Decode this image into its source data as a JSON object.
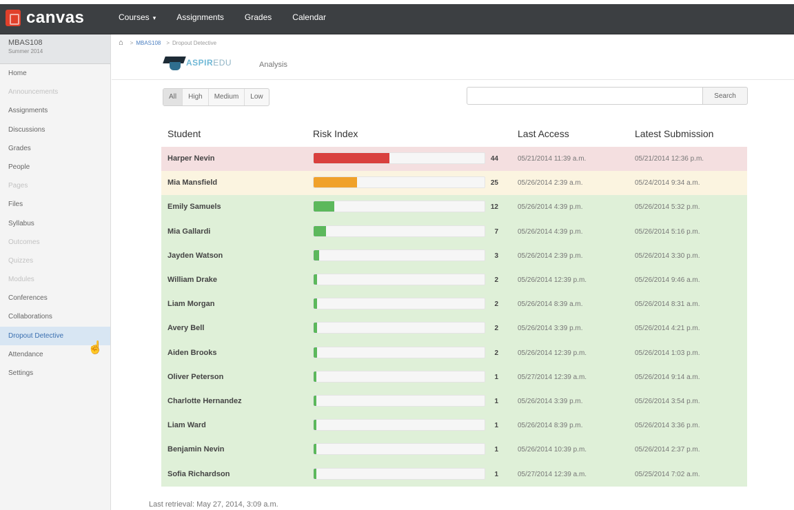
{
  "app": {
    "logo_text": "canvas"
  },
  "nav": [
    {
      "label": "Courses",
      "caret": "▾"
    },
    {
      "label": "Assignments"
    },
    {
      "label": "Grades"
    },
    {
      "label": "Calendar"
    }
  ],
  "course": {
    "code": "MBAS108",
    "term": "Summer 2014"
  },
  "sidebar": {
    "items": [
      {
        "label": "Home",
        "dim": false
      },
      {
        "label": "Announcements",
        "dim": true
      },
      {
        "label": "Assignments",
        "dim": false
      },
      {
        "label": "Discussions",
        "dim": false
      },
      {
        "label": "Grades",
        "dim": false
      },
      {
        "label": "People",
        "dim": false
      },
      {
        "label": "Pages",
        "dim": true
      },
      {
        "label": "Files",
        "dim": false
      },
      {
        "label": "Syllabus",
        "dim": false
      },
      {
        "label": "Outcomes",
        "dim": true
      },
      {
        "label": "Quizzes",
        "dim": true
      },
      {
        "label": "Modules",
        "dim": true
      },
      {
        "label": "Conferences",
        "dim": false
      },
      {
        "label": "Collaborations",
        "dim": false
      },
      {
        "label": "Dropout Detective",
        "dim": false,
        "active": true
      },
      {
        "label": "Attendance",
        "dim": false
      },
      {
        "label": "Settings",
        "dim": false
      }
    ]
  },
  "breadcrumb": {
    "course": "MBAS108",
    "separator": ">",
    "page": "Dropout Detective"
  },
  "brand": {
    "name_highlight": "ASPIR",
    "name_rest": "EDU",
    "tab": "Analysis"
  },
  "filters": [
    {
      "label": "All",
      "active": true
    },
    {
      "label": "High",
      "active": false
    },
    {
      "label": "Medium",
      "active": false
    },
    {
      "label": "Low",
      "active": false
    }
  ],
  "search": {
    "value": "",
    "placeholder": "",
    "button": "Search"
  },
  "table": {
    "headers": {
      "student": "Student",
      "risk": "Risk Index",
      "access": "Last Access",
      "submission": "Latest Submission"
    },
    "rows": [
      {
        "name": "Harper Nevin",
        "score": 44,
        "level": "high",
        "access": "05/21/2014 11:39 a.m.",
        "submission": "05/21/2014 12:36 p.m."
      },
      {
        "name": "Mia Mansfield",
        "score": 25,
        "level": "medium",
        "access": "05/26/2014 2:39 a.m.",
        "submission": "05/24/2014 9:34 a.m."
      },
      {
        "name": "Emily Samuels",
        "score": 12,
        "level": "low",
        "access": "05/26/2014 4:39 p.m.",
        "submission": "05/26/2014 5:32 p.m."
      },
      {
        "name": "Mia Gallardi",
        "score": 7,
        "level": "low",
        "access": "05/26/2014 4:39 p.m.",
        "submission": "05/26/2014 5:16 p.m."
      },
      {
        "name": "Jayden Watson",
        "score": 3,
        "level": "low",
        "access": "05/26/2014 2:39 p.m.",
        "submission": "05/26/2014 3:30 p.m."
      },
      {
        "name": "William Drake",
        "score": 2,
        "level": "low",
        "access": "05/26/2014 12:39 p.m.",
        "submission": "05/26/2014 9:46 a.m."
      },
      {
        "name": "Liam Morgan",
        "score": 2,
        "level": "low",
        "access": "05/26/2014 8:39 a.m.",
        "submission": "05/26/2014 8:31 a.m."
      },
      {
        "name": "Avery Bell",
        "score": 2,
        "level": "low",
        "access": "05/26/2014 3:39 p.m.",
        "submission": "05/26/2014 4:21 p.m."
      },
      {
        "name": "Aiden Brooks",
        "score": 2,
        "level": "low",
        "access": "05/26/2014 12:39 p.m.",
        "submission": "05/26/2014 1:03 p.m."
      },
      {
        "name": "Oliver Peterson",
        "score": 1,
        "level": "low",
        "access": "05/27/2014 12:39 a.m.",
        "submission": "05/26/2014 9:14 a.m."
      },
      {
        "name": "Charlotte Hernandez",
        "score": 1,
        "level": "low",
        "access": "05/26/2014 3:39 p.m.",
        "submission": "05/26/2014 3:54 p.m."
      },
      {
        "name": "Liam Ward",
        "score": 1,
        "level": "low",
        "access": "05/26/2014 8:39 p.m.",
        "submission": "05/26/2014 3:36 p.m."
      },
      {
        "name": "Benjamin Nevin",
        "score": 1,
        "level": "low",
        "access": "05/26/2014 10:39 p.m.",
        "submission": "05/26/2014 2:37 p.m."
      },
      {
        "name": "Sofia Richardson",
        "score": 1,
        "level": "low",
        "access": "05/27/2014 12:39 a.m.",
        "submission": "05/25/2014 7:02 a.m."
      }
    ]
  },
  "footer": {
    "last_retrieval": "Last retrieval: May 27, 2014, 3:09 a.m."
  }
}
